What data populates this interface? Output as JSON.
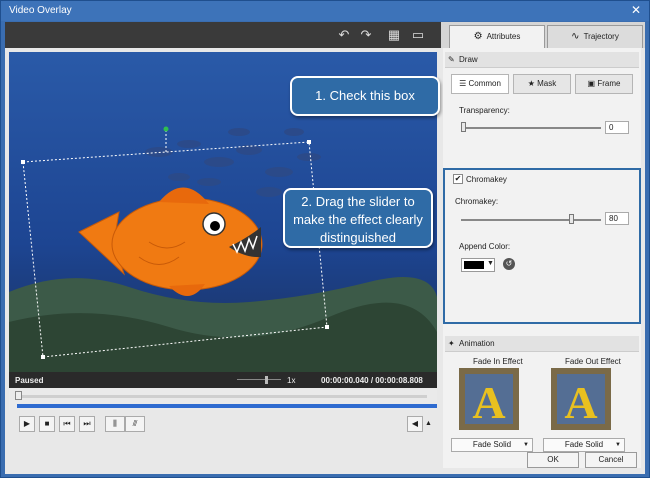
{
  "window": {
    "title": "Video Overlay",
    "close_glyph": "✕"
  },
  "toolbar": {
    "icons": [
      "undo-icon",
      "redo-icon",
      "grid-icon",
      "screen-icon"
    ],
    "undo_glyph": "↶",
    "redo_glyph": "↷",
    "grid_glyph": "▦",
    "screen_glyph": "▭"
  },
  "tabs": [
    {
      "label": "Attributes",
      "icon": "attributes-icon",
      "glyph": "⚙",
      "active": true
    },
    {
      "label": "Trajectory",
      "icon": "trajectory-icon",
      "glyph": "∿",
      "active": false
    }
  ],
  "callouts": {
    "step1": "1. Check this box",
    "step2": "2. Drag the slider to make the effect clearly distinguished"
  },
  "status": {
    "state": "Paused",
    "speed": "1x",
    "time": "00:00:00.040 / 00:00:08.808"
  },
  "draw": {
    "header": "Draw",
    "header_glyph": "✎",
    "subtabs": [
      {
        "label": "Common",
        "active": true
      },
      {
        "label": "Mask",
        "active": false
      },
      {
        "label": "Frame",
        "active": false
      }
    ],
    "transparency_label": "Transparency:",
    "transparency_value": "0",
    "transparency_fraction": 0.0,
    "chromakey_checkbox_label": "Chromakey",
    "chromakey_checked": true,
    "chromakey_label": "Chromakey:",
    "chromakey_value": "80",
    "chromakey_fraction": 0.8,
    "append_color_label": "Append Color:",
    "append_color": "#000000"
  },
  "animation": {
    "header": "Animation",
    "header_glyph": "✦",
    "fade_in_title": "Fade In Effect",
    "fade_out_title": "Fade Out Effect",
    "fade_in_value": "Fade Solid",
    "fade_out_value": "Fade Solid",
    "thumb_letter": "A"
  },
  "footer": {
    "ok": "OK",
    "cancel": "Cancel"
  },
  "colors": {
    "accent": "#2f6ba6",
    "fish": "#f07a12",
    "water": "#1c3c80"
  }
}
